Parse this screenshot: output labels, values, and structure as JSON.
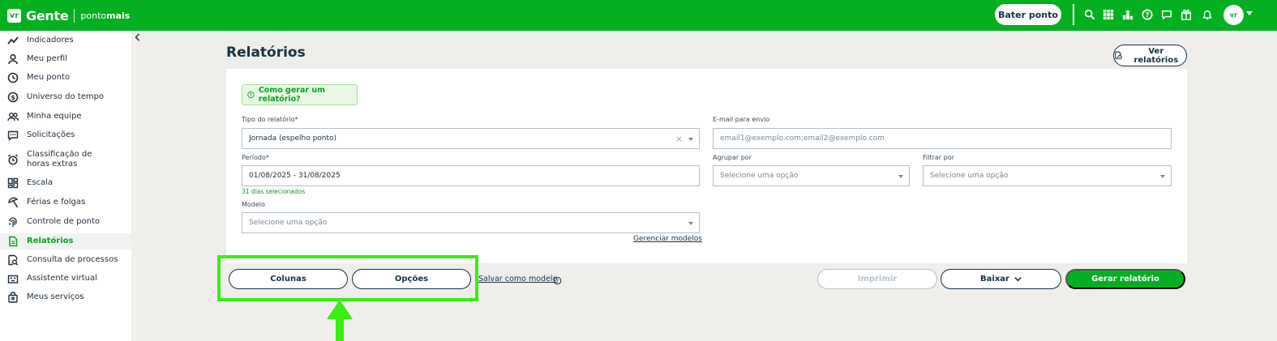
{
  "topbar": {
    "logo_text": "Gente",
    "logo_sub_prefix": "ponto",
    "logo_sub_bold": "mais",
    "bater_ponto": "Bater ponto",
    "icons": [
      "search-icon",
      "grid-icon",
      "trophy-icon",
      "help-icon",
      "chat-icon",
      "gift-icon",
      "bell-icon"
    ]
  },
  "sidebar": {
    "items": [
      {
        "label": "Indicadores",
        "icon": "trend-icon"
      },
      {
        "label": "Meu perfil",
        "icon": "user-icon"
      },
      {
        "label": "Meu ponto",
        "icon": "clock-icon"
      },
      {
        "label": "Universo do tempo",
        "icon": "dollar-icon"
      },
      {
        "label": "Minha equipe",
        "icon": "team-icon"
      },
      {
        "label": "Solicitações",
        "icon": "message-icon"
      },
      {
        "label": "Classificação de horas extras",
        "icon": "alarm-icon"
      },
      {
        "label": "Escala",
        "icon": "layout-icon"
      },
      {
        "label": "Férias e folgas",
        "icon": "umbrella-icon"
      },
      {
        "label": "Controle de ponto",
        "icon": "fingerprint-icon"
      },
      {
        "label": "Relatórios",
        "icon": "document-icon",
        "active": true
      },
      {
        "label": "Consulta de processos",
        "icon": "search-doc-icon"
      },
      {
        "label": "Assistente virtual",
        "icon": "robot-icon"
      },
      {
        "label": "Meus serviços",
        "icon": "bag-icon"
      }
    ]
  },
  "main": {
    "title": "Relatórios",
    "ver_relatorios": "Ver relatórios",
    "help_text": "Como gerar um relatório?",
    "tipo_label": "Tipo do relatório*",
    "tipo_value": "Jornada (espelho ponto)",
    "email_label": "E-mail para envio",
    "email_placeholder": "email1@exemplo.com;email2@exemplo.com",
    "periodo_label": "Período*",
    "periodo_value": "01/08/2025 - 31/08/2025",
    "dias_selecionados": "31 dias selecionados",
    "agrupar_label": "Agrupar por",
    "agrupar_placeholder": "Selecione uma opção",
    "filtrar_label": "Filtrar por",
    "filtrar_placeholder": "Selecione uma opção",
    "modelo_label": "Modelo",
    "modelo_placeholder": "Selecione uma opção",
    "gerenciar_modelos": "Gerenciar modelos"
  },
  "actions": {
    "colunas": "Colunas",
    "opcoes": "Opções",
    "salvar_modelo": "Salvar como modelo",
    "imprimir": "Imprimir",
    "baixar": "Baixar",
    "gerar": "Gerar relatório"
  },
  "colors": {
    "brand_green": "#04b020",
    "highlight_green": "#39ee15",
    "navy": "#163244"
  }
}
